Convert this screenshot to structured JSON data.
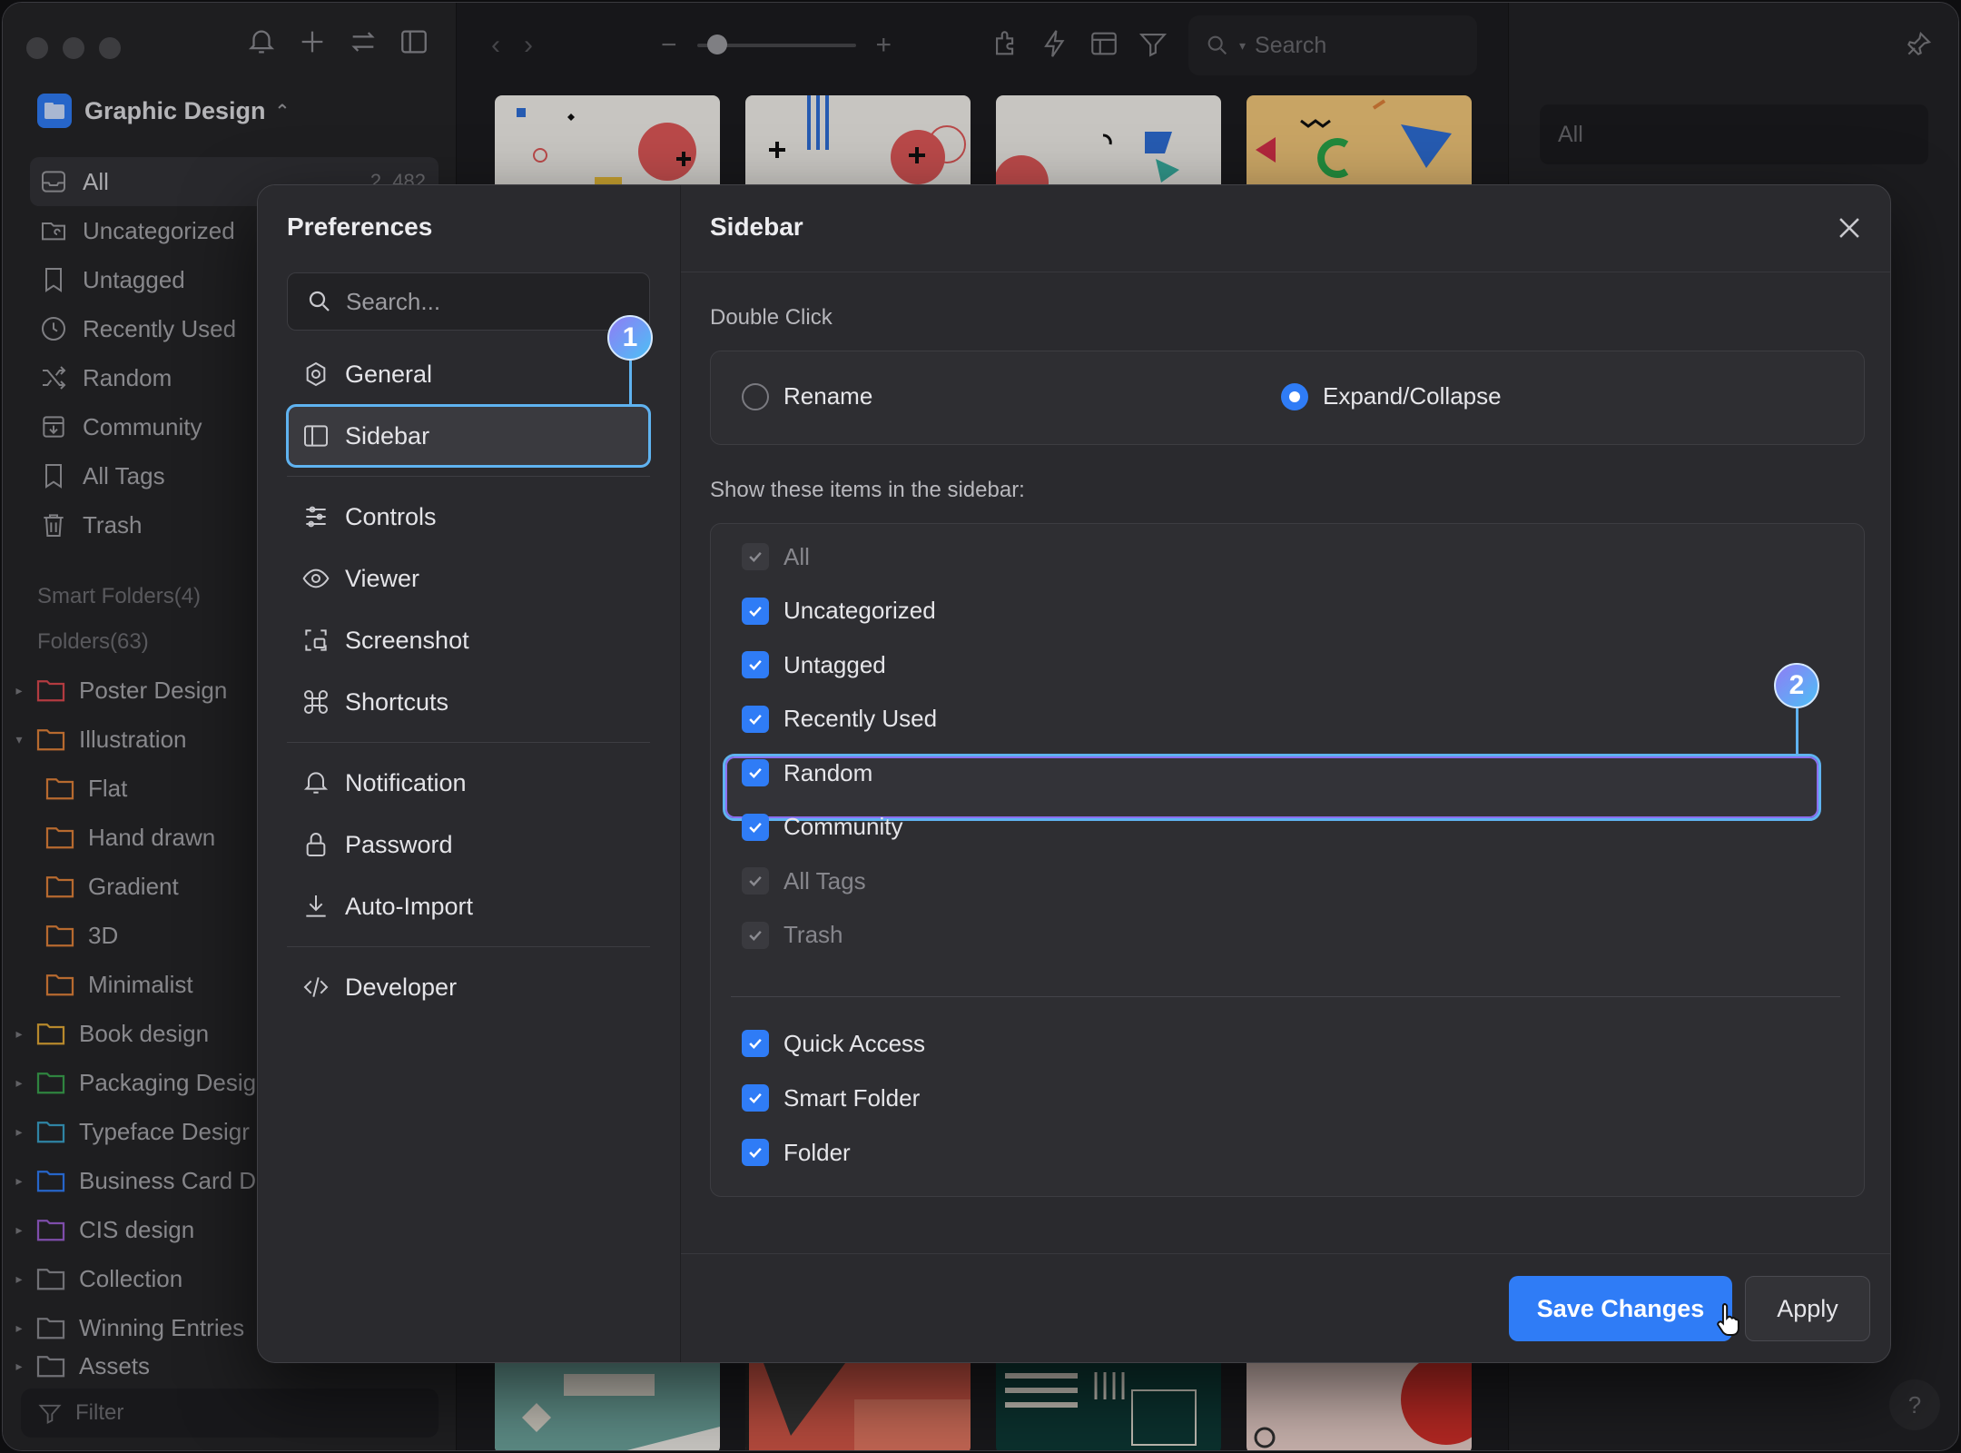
{
  "sidebar": {
    "library_name": "Graphic Design",
    "items": [
      {
        "label": "All",
        "count": "2, 482"
      },
      {
        "label": "Uncategorized"
      },
      {
        "label": "Untagged"
      },
      {
        "label": "Recently Used"
      },
      {
        "label": "Random"
      },
      {
        "label": "Community"
      },
      {
        "label": "All Tags"
      },
      {
        "label": "Trash"
      }
    ],
    "smart_folders": "Smart Folders(4)",
    "folders_header": "Folders(63)",
    "folders": [
      {
        "label": "Poster Design",
        "color": "#d9484f"
      },
      {
        "label": "Illustration",
        "color": "#e0823a"
      },
      {
        "label": "Flat",
        "color": "#e0823a"
      },
      {
        "label": "Hand drawn",
        "color": "#e0823a"
      },
      {
        "label": "Gradient",
        "color": "#e0823a"
      },
      {
        "label": "3D",
        "color": "#e0823a"
      },
      {
        "label": "Minimalist",
        "color": "#e0823a"
      },
      {
        "label": "Book design",
        "color": "#e0a836"
      },
      {
        "label": "Packaging Desig",
        "color": "#3aa14e"
      },
      {
        "label": "Typeface Desigr",
        "color": "#3aa2c8"
      },
      {
        "label": "Business Card D",
        "color": "#2f7cf6"
      },
      {
        "label": "CIS design",
        "color": "#9a5fd0"
      },
      {
        "label": "Collection",
        "color": "#8a8a90"
      },
      {
        "label": "Winning Entries",
        "color": "#8a8a90"
      },
      {
        "label": "Assets",
        "color": "#8a8a90"
      }
    ],
    "filter_placeholder": "Filter"
  },
  "toolbar": {
    "search_placeholder": "Search",
    "zoom_level": 0.1
  },
  "inspector": {
    "field_value": "All"
  },
  "preferences": {
    "title": "Preferences",
    "search_placeholder": "Search...",
    "nav": [
      {
        "label": "General",
        "icon": "gear-icon"
      },
      {
        "label": "Sidebar",
        "icon": "sidebar-icon"
      },
      {
        "label": "Controls",
        "icon": "sliders-icon"
      },
      {
        "label": "Viewer",
        "icon": "eye-icon"
      },
      {
        "label": "Screenshot",
        "icon": "screenshot-icon"
      },
      {
        "label": "Shortcuts",
        "icon": "command-icon"
      },
      {
        "label": "Notification",
        "icon": "bell-icon"
      },
      {
        "label": "Password",
        "icon": "lock-icon"
      },
      {
        "label": "Auto-Import",
        "icon": "download-icon"
      },
      {
        "label": "Developer",
        "icon": "code-icon"
      }
    ],
    "callouts": [
      "1",
      "2"
    ],
    "panel": {
      "title": "Sidebar",
      "double_click_label": "Double Click",
      "options": [
        {
          "label": "Rename",
          "selected": false
        },
        {
          "label": "Expand/Collapse",
          "selected": true
        }
      ],
      "show_items_label": "Show these items in the sidebar:",
      "items": [
        {
          "label": "All",
          "checked": true,
          "disabled": true
        },
        {
          "label": "Uncategorized",
          "checked": true,
          "disabled": false
        },
        {
          "label": "Untagged",
          "checked": true,
          "disabled": false
        },
        {
          "label": "Recently Used",
          "checked": true,
          "disabled": false
        },
        {
          "label": "Random",
          "checked": true,
          "disabled": false
        },
        {
          "label": "Community",
          "checked": true,
          "disabled": false
        },
        {
          "label": "All Tags",
          "checked": true,
          "disabled": true
        },
        {
          "label": "Trash",
          "checked": true,
          "disabled": true
        }
      ],
      "extra_items": [
        {
          "label": "Quick Access",
          "checked": true
        },
        {
          "label": "Smart Folder",
          "checked": true
        },
        {
          "label": "Folder",
          "checked": true
        }
      ]
    },
    "save_label": "Save Changes",
    "apply_label": "Apply"
  },
  "colors": {
    "accent": "#2f7cf6",
    "highlight_outline": "#5fb3f0"
  }
}
